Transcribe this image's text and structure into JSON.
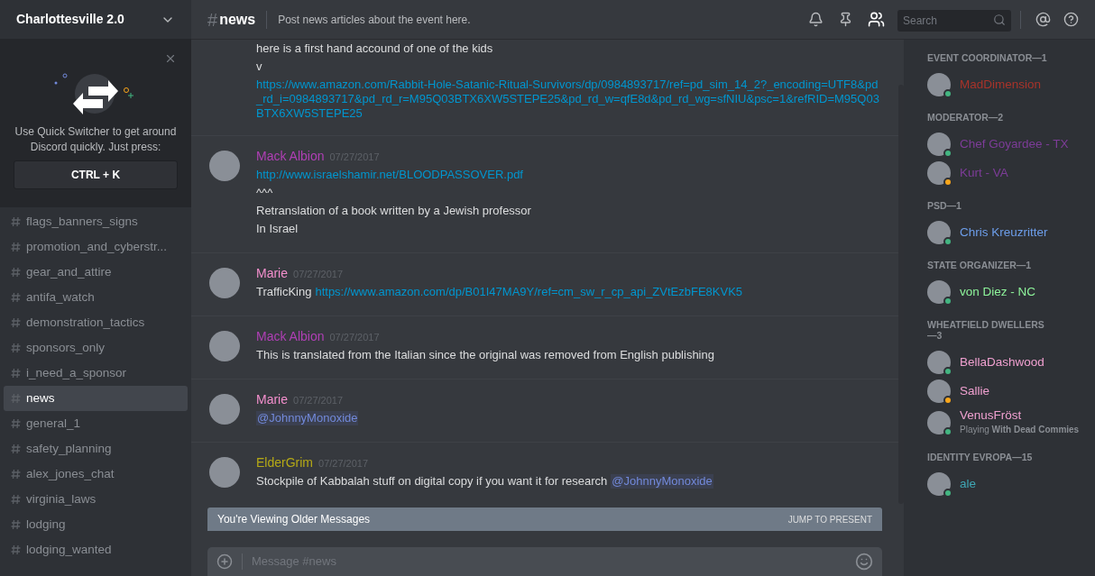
{
  "server": {
    "name": "Charlottesville 2.0"
  },
  "quick_switcher": {
    "text": "Use Quick Switcher to get around Discord quickly. Just press:",
    "shortcut": "CTRL + K"
  },
  "channels": [
    {
      "name": "flags_banners_signs",
      "selected": false
    },
    {
      "name": "promotion_and_cyberstr...",
      "selected": false
    },
    {
      "name": "gear_and_attire",
      "selected": false
    },
    {
      "name": "antifa_watch",
      "selected": false
    },
    {
      "name": "demonstration_tactics",
      "selected": false
    },
    {
      "name": "sponsors_only",
      "selected": false
    },
    {
      "name": "i_need_a_sponsor",
      "selected": false
    },
    {
      "name": "news",
      "selected": true
    },
    {
      "name": "general_1",
      "selected": false
    },
    {
      "name": "safety_planning",
      "selected": false
    },
    {
      "name": "alex_jones_chat",
      "selected": false
    },
    {
      "name": "virginia_laws",
      "selected": false
    },
    {
      "name": "lodging",
      "selected": false
    },
    {
      "name": "lodging_wanted",
      "selected": false
    }
  ],
  "header": {
    "hash": "#",
    "channel": "news",
    "topic": "Post news articles about the event here.",
    "search_placeholder": "Search"
  },
  "messages": [
    {
      "kind": "continuation",
      "lines": [
        [
          {
            "kind": "text",
            "text": "here is a first hand accound of one of the kids"
          }
        ],
        [
          {
            "kind": "text",
            "text": "v"
          }
        ],
        [
          {
            "kind": "link",
            "text": "https://www.amazon.com/Rabbit-Hole-Satanic-Ritual-Survivors/dp/0984893717/ref=pd_sim_14_2?_encoding=UTF8&pd_rd_i=0984893717&pd_rd_r=M95Q03BTX6XW5STEPE25&pd_rd_w=qfE8d&pd_rd_wg=sfNIU&psc=1&refRID=M95Q03BTX6XW5STEPE25"
          }
        ]
      ]
    },
    {
      "kind": "group",
      "author": "Mack Albion",
      "color": "#b03fb5",
      "time": "07/27/2017",
      "lines": [
        [
          {
            "kind": "link",
            "text": "http://www.israelshamir.net/BLOODPASSOVER.pdf"
          }
        ],
        [
          {
            "kind": "text",
            "text": "^^^"
          }
        ],
        [
          {
            "kind": "text",
            "text": "Retranslation of a book written by a Jewish professor"
          }
        ],
        [
          {
            "kind": "text",
            "text": "In Israel"
          }
        ]
      ]
    },
    {
      "kind": "group",
      "author": "Marie",
      "color": "#f48fcd",
      "time": "07/27/2017",
      "lines": [
        [
          {
            "kind": "text",
            "text": "TrafficKing"
          },
          {
            "kind": "link",
            "text": "https://www.amazon.com/dp/B01I47MA9Y/ref=cm_sw_r_cp_api_ZVtEzbFE8KVK5"
          }
        ]
      ]
    },
    {
      "kind": "group",
      "author": "Mack Albion",
      "color": "#b03fb5",
      "time": "07/27/2017",
      "lines": [
        [
          {
            "kind": "text",
            "text": "This is translated from the Italian since the original was removed from English publishing"
          }
        ]
      ]
    },
    {
      "kind": "group",
      "author": "Marie",
      "color": "#f48fcd",
      "time": "07/27/2017",
      "lines": [
        [
          {
            "kind": "mention",
            "text": "@JohnnyMonoxide"
          }
        ]
      ]
    },
    {
      "kind": "group",
      "author": "ElderGrim",
      "color": "#b5a916",
      "time": "07/27/2017",
      "lines": [
        [
          {
            "kind": "text",
            "text": "Stockpile of Kabbalah stuff on digital copy if you want  it for research"
          },
          {
            "kind": "mention",
            "text": "@JohnnyMonoxide"
          }
        ]
      ]
    }
  ],
  "older_banner": {
    "text": "You're Viewing Older Messages",
    "action": "JUMP TO PRESENT"
  },
  "composer": {
    "placeholder": "Message #news"
  },
  "member_groups": [
    {
      "title": "EVENT COORDINATOR—1",
      "members": [
        {
          "name": "MadDimension",
          "color": "#a8332a",
          "idle": false
        }
      ]
    },
    {
      "title": "MODERATOR—2",
      "members": [
        {
          "name": "Chef Goyardee - TX",
          "color": "#7d3c98",
          "idle": false
        },
        {
          "name": "Kurt - VA",
          "color": "#7d3c98",
          "idle": true
        }
      ]
    },
    {
      "title": "PSD—1",
      "members": [
        {
          "name": "Chris Kreuzritter",
          "color": "#6d9eeb",
          "idle": false
        }
      ]
    },
    {
      "title": "STATE ORGANIZER—1",
      "members": [
        {
          "name": "von Diez - NC",
          "color": "#8ef59b",
          "idle": false
        }
      ]
    },
    {
      "title": "WHEATFIELD DWELLERS—3",
      "members": [
        {
          "name": "BellaDashwood",
          "color": "#f0a0d0",
          "idle": false
        },
        {
          "name": "Sallie",
          "color": "#f0a0d0",
          "idle": true
        },
        {
          "name": "VenusFröst",
          "color": "#f0a0d0",
          "idle": false,
          "activity": "Playing **With Dead Commies**"
        }
      ]
    },
    {
      "title": "IDENTITY EVROPA—15",
      "members": [
        {
          "name": "ale",
          "color": "#3fa7b5",
          "idle": false
        }
      ]
    }
  ]
}
